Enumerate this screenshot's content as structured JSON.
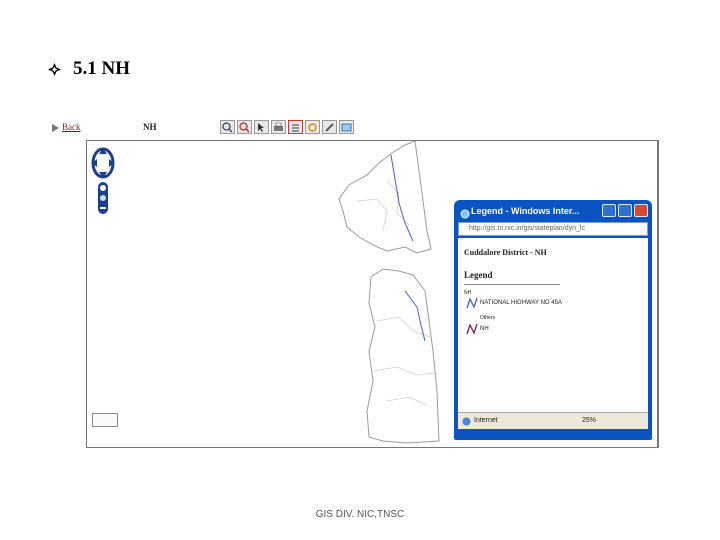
{
  "slide": {
    "title": "5.1 NH",
    "footer": "GIS DIV. NIC,TNSC"
  },
  "app": {
    "back_label": "Back",
    "layer_label": "NH",
    "toolbar_icons": [
      "zoom-in-icon",
      "zoom-out-icon",
      "select-icon",
      "print-icon",
      "legend-icon",
      "refresh-icon",
      "edit-icon",
      "layers-icon"
    ],
    "map_colors": {
      "boundary": "#9a9a9a",
      "highway": "#4a5fd0",
      "taluk": "#cfcfcf"
    }
  },
  "popup": {
    "title": "Legend - Windows Inter...",
    "address": "http://gis.tn.nic.in/gis/stateplan/dyn_lc",
    "address_bold": "nic",
    "heading": "Cuddalore District - NH",
    "legend_title": "Legend",
    "groups": [
      {
        "label": "NH",
        "item": "NATIONAL HIGHWAY NO 45A",
        "color": "#4a5fd0"
      },
      {
        "label": "Others",
        "item": "NH",
        "color": "#7a1f5a"
      }
    ],
    "status_zone": "Internet",
    "zoom": "25%"
  }
}
